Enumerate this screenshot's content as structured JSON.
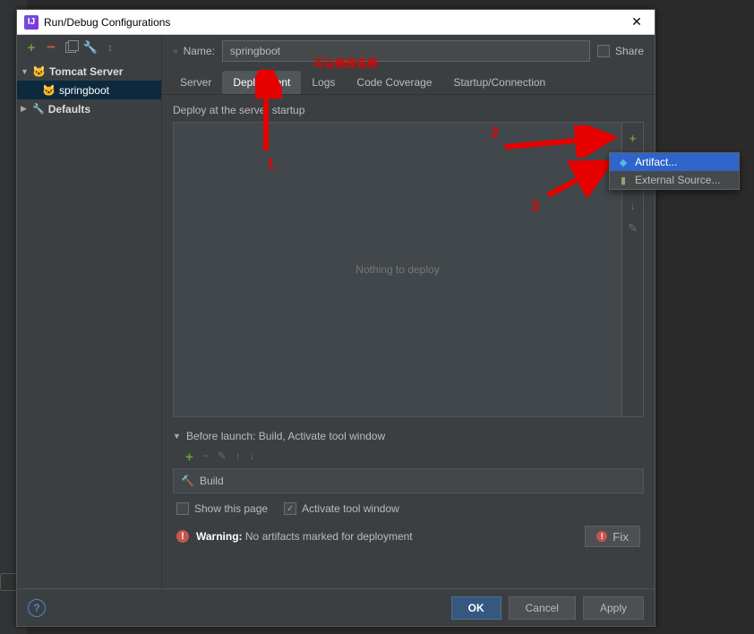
{
  "titlebar": {
    "title": "Run/Debug Configurations"
  },
  "sidebar": {
    "tomcat": "Tomcat Server",
    "config": "springboot",
    "defaults": "Defaults"
  },
  "main": {
    "name_label": "Name:",
    "name_value": "springboot",
    "share_label": "Share",
    "tabs": [
      "Server",
      "Deployment",
      "Logs",
      "Code Coverage",
      "Startup/Connection"
    ],
    "deploy_header": "Deploy at the server startup",
    "nothing": "Nothing to deploy",
    "before_launch": "Before launch: Build, Activate tool window",
    "build_item": "Build",
    "show_page": "Show this page",
    "activate_tw": "Activate tool window",
    "warning_label": "Warning:",
    "warning_text": "No artifacts marked for deployment",
    "fix": "Fix"
  },
  "popup": {
    "artifact": "Artifact...",
    "external": "External Source..."
  },
  "footer": {
    "ok": "OK",
    "cancel": "Cancel",
    "apply": "Apply"
  },
  "annotations": {
    "rename": "可以修改名称",
    "one": "1",
    "two": "2",
    "three": "3"
  }
}
